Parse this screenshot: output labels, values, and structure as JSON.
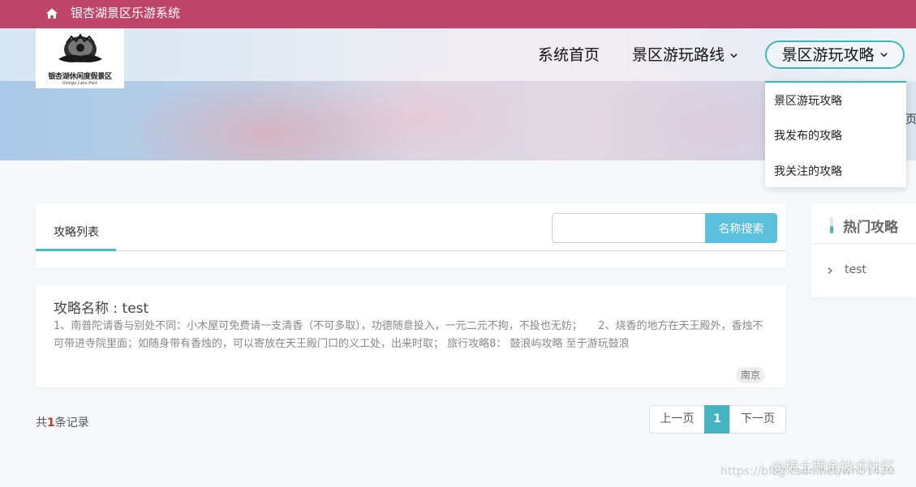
{
  "topbar": {
    "title": "银杏湖景区乐游系统",
    "home_icon": "home-icon"
  },
  "logo": {
    "name": "银杏湖休闲度假景区",
    "tagline": "Ginkgo Lake Park"
  },
  "nav": {
    "home": "系统首页",
    "routes": "景区游玩路线",
    "guides": "景区游玩攻略",
    "dropdown": [
      "景区游玩攻略",
      "我发布的攻略",
      "我关注的攻略"
    ],
    "edge_char": "页"
  },
  "list": {
    "tab": "攻略列表",
    "search_placeholder": "",
    "search_button": "名称搜索",
    "items": [
      {
        "title": "攻略名称 : test",
        "desc": "1、南普陀请香与别处不同：小木屋可免费请一支清香（不可多取），功德随意投入，一元二元不拘，不投也无妨；　　2、烧香的地方在天王殿外，香烛不可带进寺院里面；如随身带有香烛的，可以寄放在天王殿门口的义工处，出来时取；  旅行攻略8： 鼓浪屿攻略 至于游玩鼓浪",
        "tag": "南京"
      }
    ]
  },
  "pagination": {
    "count_prefix": "共",
    "count": "1",
    "count_suffix": "条记录",
    "prev": "上一页",
    "current": "1",
    "next": "下一页"
  },
  "hot": {
    "title": "热门攻略",
    "items": [
      "test"
    ]
  },
  "watermark": {
    "url": "https://blog.csdn.net/whb1420",
    "text": "@稀土掘金技术社区"
  },
  "colors": {
    "topbar": "#c0456a",
    "accent": "#3fb8b4",
    "search_button": "#5bc0de",
    "pager_active": "#46b3c2"
  }
}
